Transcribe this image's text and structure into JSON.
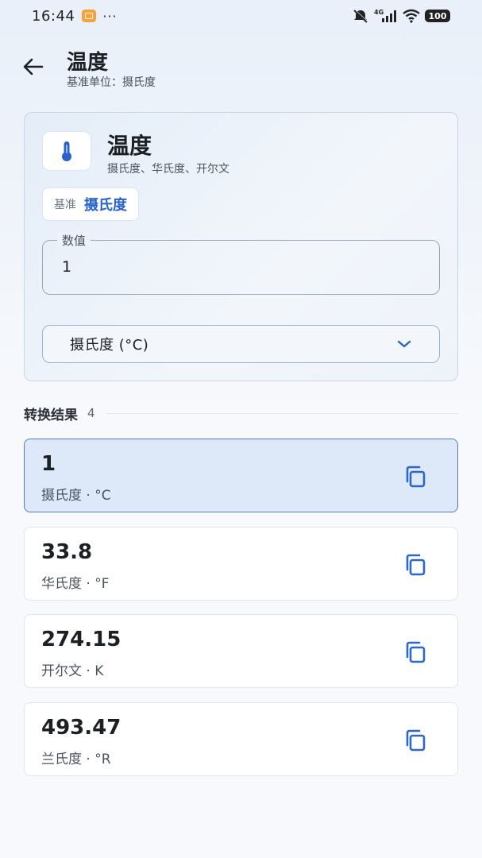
{
  "status_bar": {
    "time": "16:44",
    "dots": "···",
    "network": "4G",
    "battery": "100"
  },
  "header": {
    "title": "温度",
    "subtitle": "基准单位：摄氏度",
    "back_icon": "arrow-left-icon"
  },
  "category": {
    "icon": "thermometer-icon",
    "title": "温度",
    "units_summary": "摄氏度、华氏度、开尔文",
    "base_chip_label": "基准",
    "base_chip_value": "摄氏度"
  },
  "input": {
    "legend": "数值",
    "value": "1"
  },
  "unit_select": {
    "selected": "摄氏度 (°C)",
    "chevron_icon": "chevron-down-icon"
  },
  "results": {
    "title": "转换结果",
    "count": "4",
    "items": [
      {
        "value": "1",
        "unit": "摄氏度 · °C",
        "active": true
      },
      {
        "value": "33.8",
        "unit": "华氏度 · °F",
        "active": false
      },
      {
        "value": "274.15",
        "unit": "开尔文 · K",
        "active": false
      },
      {
        "value": "493.47",
        "unit": "兰氏度 · °R",
        "active": false
      }
    ]
  },
  "colors": {
    "accent": "#2a62c9",
    "active_card_bg": "#dde9f8",
    "active_card_border": "#4f7fc1",
    "copy_icon": "#2c68c8"
  }
}
